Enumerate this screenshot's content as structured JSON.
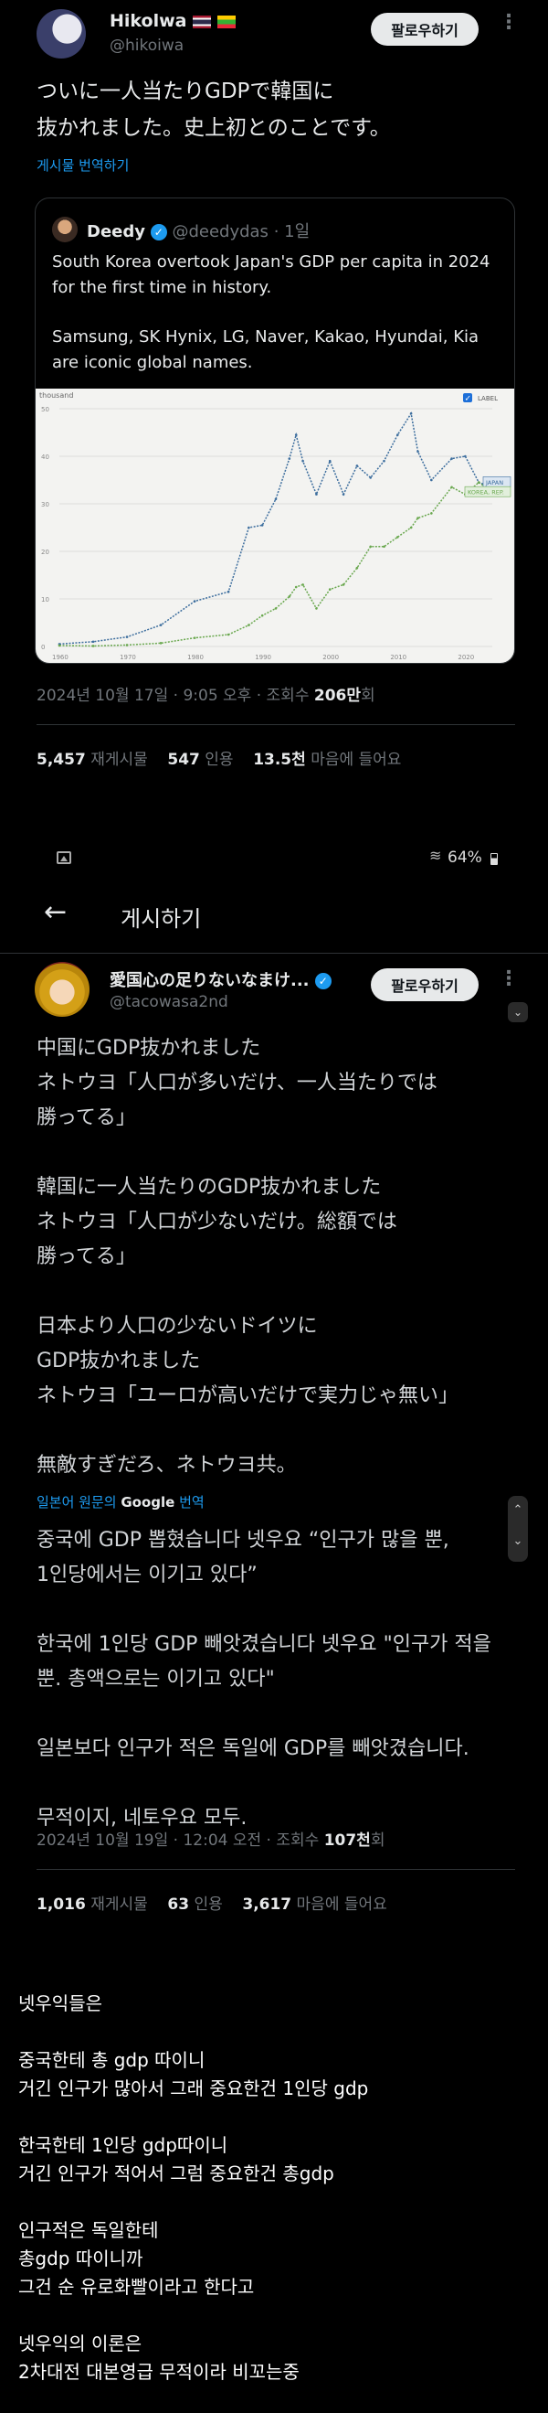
{
  "post1": {
    "display_name": "Hikolwa",
    "handle": "@hikoiwa",
    "follow_label": "팔로우하기",
    "text": "ついに一人当たりGDPで韓国に\n抜かれました。史上初とのことです。",
    "translate_label": "게시물 번역하기",
    "quote": {
      "name": "Deedy",
      "handle": "@deedydas",
      "time": "· 1일",
      "text1": "South Korea overtook Japan's GDP per capita in 2024 for the first time in history.",
      "text2": "Samsung, SK Hynix, LG, Naver, Kakao, Hyundai, Kia are iconic global names."
    },
    "timestamp": "2024년 10월 17일 · 9:05 오후 · 조회수 ",
    "views": "206만",
    "views_suffix": "회",
    "stats": {
      "reposts_n": "5,457",
      "reposts_l": "재게시물",
      "quotes_n": "547",
      "quotes_l": "인용",
      "likes_n": "13.5천",
      "likes_l": "마음에 들어요"
    }
  },
  "chart_data": {
    "type": "line",
    "ytitle": "thousand",
    "legend_label": "LABEL",
    "x": [
      1960,
      1965,
      1970,
      1975,
      1980,
      1985,
      1988,
      1990,
      1992,
      1994,
      1995,
      1996,
      1998,
      2000,
      2002,
      2004,
      2006,
      2008,
      2010,
      2012,
      2013,
      2015,
      2018,
      2020,
      2022,
      2023,
      2024
    ],
    "xlim": [
      1960,
      2024
    ],
    "ylim": [
      0,
      50
    ],
    "yticks": [
      0,
      10,
      20,
      30,
      40,
      50
    ],
    "xticks": [
      1960,
      1970,
      1980,
      1990,
      2000,
      2010,
      2020
    ],
    "series": [
      {
        "name": "JAPAN",
        "color": "#3d6e9e",
        "values": [
          0.5,
          1,
          2,
          4.5,
          9.5,
          11.5,
          25,
          25.5,
          31,
          39.5,
          44.5,
          39,
          32,
          39,
          32,
          38,
          35.5,
          39,
          44.5,
          49,
          41,
          35,
          39.5,
          40,
          34.5,
          34,
          33
        ]
      },
      {
        "name": "KOREA, REP.",
        "color": "#6aa84f",
        "values": [
          0.2,
          0.1,
          0.3,
          0.7,
          1.8,
          2.5,
          4.5,
          6.5,
          8,
          10.5,
          12.5,
          13,
          8,
          12,
          13,
          16.5,
          21,
          21,
          23,
          25,
          27,
          28,
          33.5,
          32,
          34.5,
          33.5,
          34
        ]
      }
    ]
  },
  "status_bar": {
    "battery": "64%"
  },
  "nav": {
    "title": "게시하기"
  },
  "post2": {
    "display_name": "愛国心の足りないなまけ...",
    "handle": "@tacowasa2nd",
    "follow_label": "팔로우하기",
    "text": "中国にGDP抜かれました\nネトウヨ「人口が多いだけ、一人当たりでは\n勝ってる」\n\n韓国に一人当たりのGDP抜かれました\nネトウヨ「人口が少ないだけ。総額では\n勝ってる」\n\n日本より人口の少ないドイツに\nGDP抜かれました\nネトウヨ「ユーロが高いだけで実力じゃ無い」\n\n無敵すぎだろ、ネトウヨ共。",
    "translate_prefix": "일본어 원문의 ",
    "translate_brand": "Google",
    "translate_suffix": " 번역",
    "translation": "중국에 GDP 뽑혔습니다 넷우요 “인구가 많을 뿐,\n1인당에서는 이기고 있다”\n\n한국에 1인당 GDP 빼앗겼습니다 넷우요 \"인구가 적을\n뿐. 총액으로는 이기고 있다\"\n\n일본보다 인구가 적은 독일에 GDP를 빼앗겼습니다.\n\n무적이지, 네토우요 모두.",
    "timestamp": "2024년 10월 19일 · 12:04 오전 · 조회수 ",
    "views": "107천",
    "views_suffix": "회",
    "stats": {
      "reposts_n": "1,016",
      "reposts_l": "재게시물",
      "quotes_n": "63",
      "quotes_l": "인용",
      "likes_n": "3,617",
      "likes_l": "마음에 들어요"
    }
  },
  "commentary": "넷우익들은\n\n중국한테 총 gdp 따이니\n거긴 인구가 많아서 그래 중요한건 1인당 gdp\n\n한국한테 1인당 gdp따이니\n거긴 인구가 적어서 그럼 중요한건 총gdp\n\n인구적은 독일한테\n총gdp 따이니까\n그건 순 유로화빨이라고 한다고\n\n넷우익의 이론은\n2차대전 대본영급 무적이라 비꼬는중"
}
